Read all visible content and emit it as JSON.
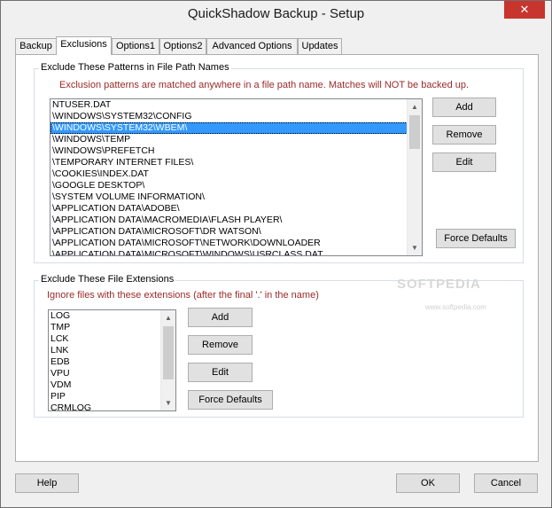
{
  "window": {
    "title": "QuickShadow Backup - Setup",
    "close_glyph": "✕"
  },
  "tabs": [
    {
      "label": "Backup"
    },
    {
      "label": "Exclusions"
    },
    {
      "label": "Options1"
    },
    {
      "label": "Options2"
    },
    {
      "label": "Advanced Options"
    },
    {
      "label": "Updates"
    }
  ],
  "patterns": {
    "group_title": "Exclude These Patterns in File Path Names",
    "hint": "Exclusion patterns are matched anywhere in a file path name. Matches will NOT be backed up.",
    "items": [
      "NTUSER.DAT",
      "\\WINDOWS\\SYSTEM32\\CONFIG",
      "\\WINDOWS\\SYSTEM32\\WBEM\\",
      "\\WINDOWS\\TEMP",
      "\\WINDOWS\\PREFETCH",
      "\\TEMPORARY INTERNET FILES\\",
      "\\COOKIES\\INDEX.DAT",
      "\\GOOGLE DESKTOP\\",
      "\\SYSTEM VOLUME INFORMATION\\",
      "\\APPLICATION DATA\\ADOBE\\",
      "\\APPLICATION DATA\\MACROMEDIA\\FLASH PLAYER\\",
      "\\APPLICATION DATA\\MICROSOFT\\DR WATSON\\",
      "\\APPLICATION DATA\\MICROSOFT\\NETWORK\\DOWNLOADER",
      "\\APPLICATION DATA\\MICROSOFT\\WINDOWS\\USRCLASS.DAT"
    ],
    "selected_index": 2,
    "add_label": "Add",
    "remove_label": "Remove",
    "edit_label": "Edit",
    "force_defaults_label": "Force Defaults"
  },
  "extensions": {
    "group_title": "Exclude These File Extensions",
    "hint": "Ignore files with these extensions (after the final '.' in the name)",
    "items": [
      "LOG",
      "TMP",
      "LCK",
      "LNK",
      "EDB",
      "VPU",
      "VDM",
      "PIP",
      "CRMLOG"
    ],
    "add_label": "Add",
    "remove_label": "Remove",
    "edit_label": "Edit",
    "force_defaults_label": "Force Defaults"
  },
  "watermark": {
    "text": "SOFTPEDIA",
    "sub": "www.softpedia.com"
  },
  "footer": {
    "help_label": "Help",
    "ok_label": "OK",
    "cancel_label": "Cancel"
  },
  "colors": {
    "selection": "#3399ff",
    "hint_text": "#9a2a2a",
    "close_button": "#c7352e"
  },
  "scrollbar_icons": {
    "up": "triangle-up-icon",
    "down": "triangle-down-icon"
  }
}
